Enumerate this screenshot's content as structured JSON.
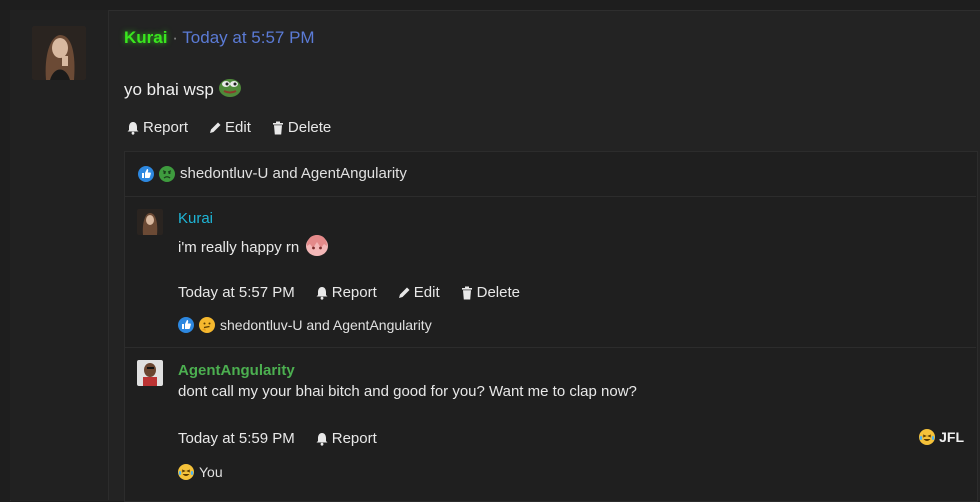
{
  "post": {
    "author": "Kurai",
    "separator": "·",
    "time": "Today at 5:57 PM",
    "body": "yo bhai wsp",
    "body_emoji": "pepe-frog-emoji",
    "actions": {
      "report": "Report",
      "edit": "Edit",
      "delete": "Delete"
    },
    "reactions": {
      "icons": [
        "like-icon",
        "angry-icon"
      ],
      "text": "shedontluv-U and AgentAngularity"
    }
  },
  "replies": [
    {
      "author": "Kurai",
      "author_color": "#1fb5d6",
      "text": "i'm really happy rn",
      "emoji": "anime-girl-emoji",
      "time": "Today at 5:57 PM",
      "actions": {
        "report": "Report",
        "edit": "Edit",
        "delete": "Delete"
      },
      "reactions": {
        "icons": [
          "like-icon",
          "thinking-icon"
        ],
        "text": "shedontluv-U and AgentAngularity"
      }
    },
    {
      "author": "AgentAngularity",
      "author_color": "#4caf50",
      "text": "dont call my your bhai bitch and good for you? Want me to clap now?",
      "time": "Today at 5:59 PM",
      "actions": {
        "report": "Report"
      },
      "reactions": {
        "icons": [
          "laughing-crying-icon"
        ],
        "text": "You"
      },
      "tag": {
        "icon": "laughing-crying-icon",
        "text": "JFL"
      }
    }
  ],
  "colors": {
    "accent_link": "#5b7bd6",
    "main_author": "#39e61e",
    "background": "#1e1e1e"
  }
}
